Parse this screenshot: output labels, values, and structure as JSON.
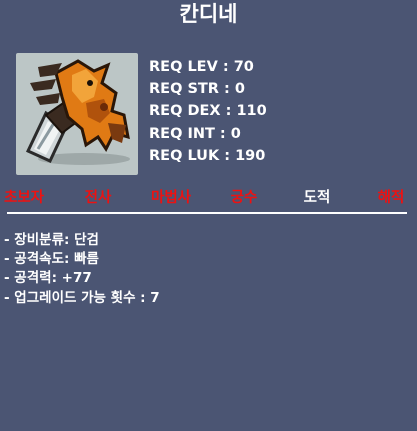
{
  "item": {
    "name": "칸디네",
    "icon": "weapon-sprite-icon"
  },
  "requirements": [
    {
      "label": "REQ LEV : 70"
    },
    {
      "label": "REQ STR : 0"
    },
    {
      "label": "REQ DEX : 110"
    },
    {
      "label": "REQ INT : 0"
    },
    {
      "label": "REQ LUK : 190"
    }
  ],
  "jobs": [
    {
      "label": "초보자",
      "allowed": false
    },
    {
      "label": "전사",
      "allowed": false
    },
    {
      "label": "마법사",
      "allowed": false
    },
    {
      "label": "궁수",
      "allowed": false
    },
    {
      "label": "도적",
      "allowed": true
    },
    {
      "label": "해적",
      "allowed": false
    }
  ],
  "stats": [
    {
      "label": "- 장비분류: 단검"
    },
    {
      "label": "- 공격속도: 빠름"
    },
    {
      "label": "- 공격력: +77"
    },
    {
      "label": "- 업그레이드 가능 횟수 : 7"
    }
  ],
  "colors": {
    "background": "#4b5573",
    "job_disallowed": "#ee1111",
    "job_allowed": "#ffffff",
    "icon_background": "#bcc6c6"
  }
}
